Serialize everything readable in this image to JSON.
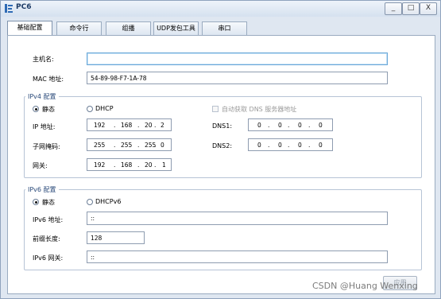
{
  "window": {
    "title": "PC6"
  },
  "titlebar_buttons": {
    "minimize": "_",
    "maximize": "□",
    "close": "X"
  },
  "tabs": [
    "基础配置",
    "命令行",
    "组播",
    "UDP发包工具",
    "串口"
  ],
  "basic": {
    "hostname_label": "主机名:",
    "hostname_value": "",
    "mac_label": "MAC 地址:",
    "mac_value": "54-89-98-F7-1A-78"
  },
  "ipv4": {
    "legend": "IPv4 配置",
    "static_label": "静态",
    "dhcp_label": "DHCP",
    "auto_dns_label": "自动获取 DNS 服务器地址",
    "ip_label": "IP 地址:",
    "ip": [
      "192",
      "168",
      "20",
      "2"
    ],
    "mask_label": "子网掩码:",
    "mask": [
      "255",
      "255",
      "255",
      "0"
    ],
    "gateway_label": "网关:",
    "gateway": [
      "192",
      "168",
      "20",
      "1"
    ],
    "dns1_label": "DNS1:",
    "dns1": [
      "0",
      "0",
      "0",
      "0"
    ],
    "dns2_label": "DNS2:",
    "dns2": [
      "0",
      "0",
      "0",
      "0"
    ]
  },
  "ipv6": {
    "legend": "IPv6 配置",
    "static_label": "静态",
    "dhcp_label": "DHCPv6",
    "ip_label": "IPv6 地址:",
    "ip_value": "::",
    "prefix_label": "前缀长度:",
    "prefix_value": "128",
    "gateway_label": "IPv6 网关:",
    "gateway_value": "::"
  },
  "apply_label": "应用",
  "watermark": "CSDN @Huang Wenxing"
}
